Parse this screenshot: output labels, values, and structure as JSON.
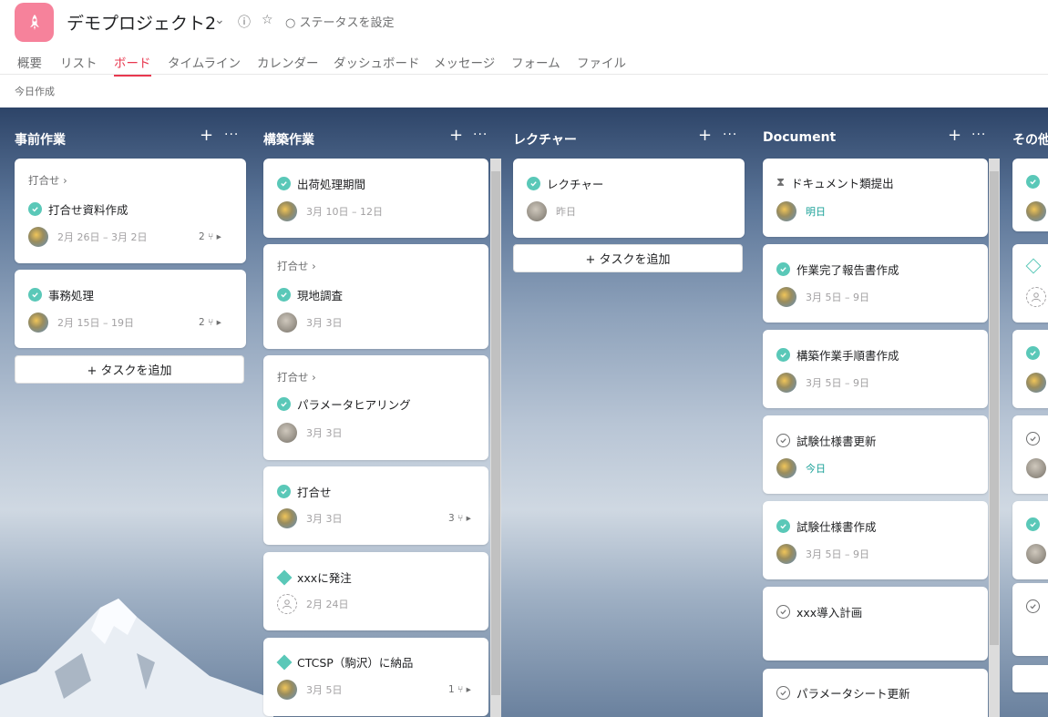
{
  "project": {
    "title": "デモプロジェクト2",
    "status_label": "ステータスを設定",
    "icon": "rocket-icon",
    "icon_bg": "#f6829b"
  },
  "tabs": [
    "概要",
    "リスト",
    "ボード",
    "タイムライン",
    "カレンダー",
    "ダッシュボード",
    "メッセージ",
    "フォーム",
    "ファイル"
  ],
  "active_tab": "ボード",
  "subbar": "今日作成",
  "add_task_label": "+ タスクを追加",
  "accent_color": "#e8384f",
  "columns": [
    {
      "title": "事前作業",
      "cards": [
        {
          "section": "打合せ ›",
          "name": "打合せ資料作成",
          "date": "2月 26日 – 3月 2日",
          "subtasks": "2 ⑂ ▸"
        },
        {
          "name": "事務処理",
          "date": "2月 15日 – 19日",
          "subtasks": "2 ⑂ ▸"
        }
      ]
    },
    {
      "title": "構築作業",
      "cards": [
        {
          "name": "出荷処理期間",
          "date": "3月 10日 – 12日"
        },
        {
          "section": "打合せ ›",
          "name": "現地調査",
          "date": "3月 3日"
        },
        {
          "section": "打合せ ›",
          "name": "パラメータヒアリング",
          "date": "3月 3日"
        },
        {
          "name": "打合せ",
          "date": "3月 3日",
          "subtasks": "3 ⑂ ▸"
        },
        {
          "name": "xxxに発注",
          "date": "2月 24日"
        },
        {
          "name": "CTCSP（駒沢）に納品",
          "date": "3月 5日",
          "subtasks": "1 ⑂ ▸"
        }
      ]
    },
    {
      "title": "レクチャー",
      "cards": [
        {
          "name": "レクチャー",
          "date": "昨日"
        }
      ]
    },
    {
      "title": "Document",
      "cards": [
        {
          "name": "ドキュメント類提出",
          "date": "明日"
        },
        {
          "name": "作業完了報告書作成",
          "date": "3月 5日 – 9日"
        },
        {
          "name": "構築作業手順書作成",
          "date": "3月 5日 – 9日"
        },
        {
          "name": "試験仕様書更新",
          "date": "今日"
        },
        {
          "name": "試験仕様書作成",
          "date": "3月 5日 – 9日"
        },
        {
          "name": "xxx導入計画"
        },
        {
          "name": "パラメータシート更新"
        }
      ]
    },
    {
      "title": "その他",
      "cards": []
    }
  ]
}
